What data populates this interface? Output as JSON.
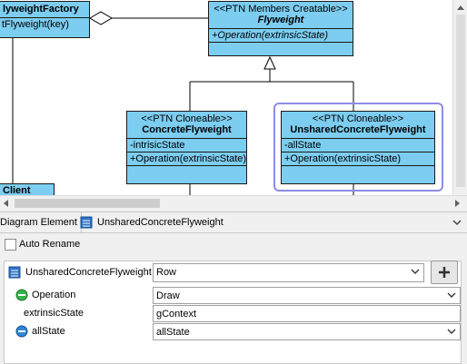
{
  "diagram": {
    "flyweight_factory": {
      "name": "lyweightFactory",
      "operation": "tFlyweight(key)"
    },
    "flyweight": {
      "stereotype": "<<PTN Members Creatable>>",
      "name": "Flyweight",
      "operation": "+Operation(extrinsicState)"
    },
    "concrete_flyweight": {
      "stereotype": "<<PTN Cloneable>>",
      "name": "ConcreteFlyweight",
      "attribute": "-intrisicState",
      "operation": "+Operation(extrinsicState)"
    },
    "unshared_concrete_flyweight": {
      "stereotype": "<<PTN Cloneable>>",
      "name": "UnsharedConcreteFlyweight",
      "attribute": "-allState",
      "operation": "+Operation(extrinsicState)"
    },
    "client": {
      "name": "Client"
    }
  },
  "tabs": {
    "diagram_element_label": "Diagram Element",
    "element_label": "UnsharedConcreteFlyweight"
  },
  "properties": {
    "auto_rename_label": "Auto Rename",
    "auto_rename_checked": false,
    "rows": [
      {
        "label": "UnsharedConcreteFlyweight",
        "icon": "class-icon",
        "value": "Row",
        "kind": "dropdown"
      },
      {
        "label": "Operation",
        "icon": "operation-icon",
        "value": "Draw",
        "kind": "dropdown"
      },
      {
        "label": "extrinsicState",
        "icon": "",
        "value": "gContext",
        "kind": "text"
      },
      {
        "label": "allState",
        "icon": "attribute-icon",
        "value": "allState",
        "kind": "dropdown"
      }
    ],
    "add_button_label": "+"
  },
  "colors": {
    "uml_fill": "#7ccdf0",
    "selection": "#8c8ce6",
    "operation_icon": "#35b24a",
    "class_icon": "#2e73c6"
  }
}
